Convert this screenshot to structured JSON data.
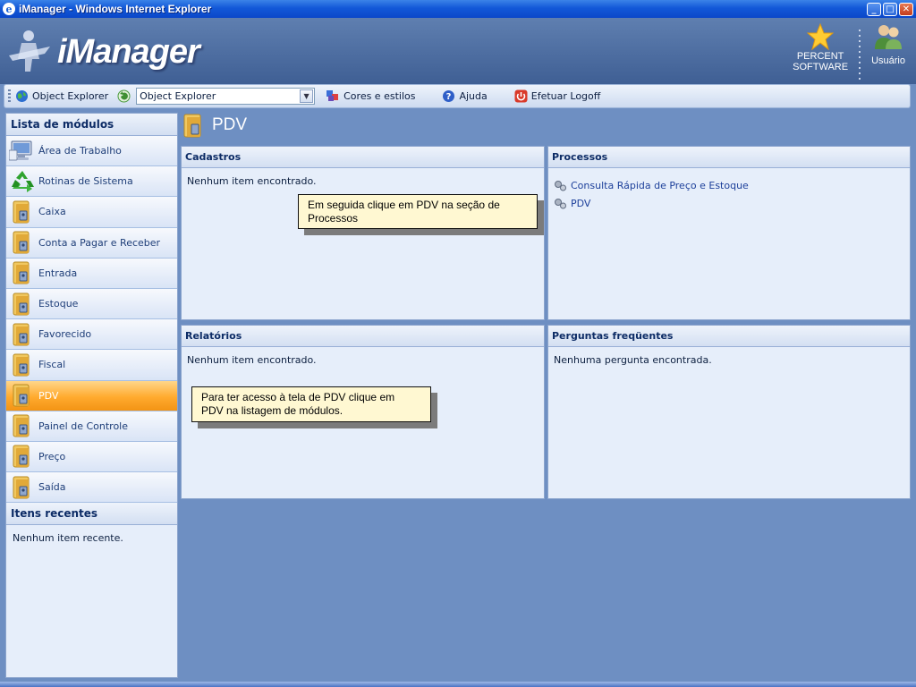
{
  "window": {
    "title": "iManager - Windows Internet Explorer"
  },
  "header": {
    "logo_text": "iManager",
    "company_line1": "PERCENT",
    "company_line2": "SOFTWARE",
    "user_label": "Usuário"
  },
  "toolbar": {
    "object_explorer_label": "Object Explorer",
    "select_value": "Object Explorer",
    "cores_label": "Cores e estilos",
    "ajuda_label": "Ajuda",
    "logoff_label": "Efetuar Logoff"
  },
  "sidebar": {
    "modules_title": "Lista de módulos",
    "modules": [
      {
        "label": "Área de Trabalho",
        "icon": "desktop-icon"
      },
      {
        "label": "Rotinas de Sistema",
        "icon": "recycle-icon"
      },
      {
        "label": "Caixa",
        "icon": "folder-icon"
      },
      {
        "label": "Conta a Pagar e Receber",
        "icon": "folder-icon"
      },
      {
        "label": "Entrada",
        "icon": "folder-icon"
      },
      {
        "label": "Estoque",
        "icon": "folder-icon"
      },
      {
        "label": "Favorecido",
        "icon": "folder-icon"
      },
      {
        "label": "Fiscal",
        "icon": "folder-icon"
      },
      {
        "label": "PDV",
        "icon": "folder-icon",
        "active": true
      },
      {
        "label": "Painel de Controle",
        "icon": "folder-icon"
      },
      {
        "label": "Preço",
        "icon": "folder-icon"
      },
      {
        "label": "Saída",
        "icon": "folder-icon"
      }
    ],
    "recent_title": "Itens recentes",
    "recent_empty": "Nenhum item recente."
  },
  "main": {
    "title": "PDV",
    "cadastros": {
      "title": "Cadastros",
      "empty": "Nenhum item encontrado."
    },
    "processos": {
      "title": "Processos",
      "items": [
        "Consulta Rápida de Preço e Estoque",
        "PDV"
      ]
    },
    "relatorios": {
      "title": "Relatórios",
      "empty": "Nenhum item encontrado."
    },
    "perguntas": {
      "title": "Perguntas freqüentes",
      "empty": "Nenhuma pergunta encontrada."
    }
  },
  "callouts": {
    "processos_line1": "Em seguida clique em PDV na seção de",
    "processos_line2": "Processos",
    "modulos_line1": "Para ter acesso à tela de PDV clique em",
    "modulos_line2": "PDV na listagem de módulos."
  },
  "colors": {
    "accent_active": "#ffaa2e",
    "header_bg": "#4f6fa2",
    "panel_bg": "#e6eefa"
  }
}
